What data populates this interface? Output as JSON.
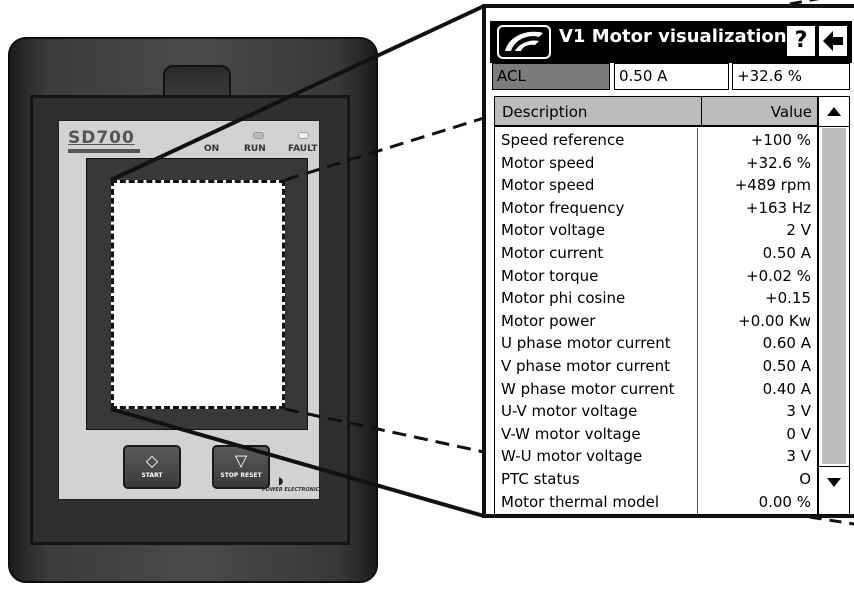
{
  "device": {
    "brand": "SD700",
    "led_labels": {
      "on": "ON",
      "run": "RUN",
      "fault": "FAULT"
    },
    "buttons": {
      "start": "START",
      "stop_reset": "STOP RESET"
    },
    "manufacturer": "POWER ELECTRONICS"
  },
  "screen": {
    "title": "V1 Motor visualization",
    "help_label": "?",
    "back_label": "🡄",
    "status": {
      "mode": "ACL",
      "current": "0.50 A",
      "speed": "+32.6 %"
    },
    "table": {
      "columns": [
        "Description",
        "Value"
      ],
      "rows": [
        {
          "description": "Speed reference",
          "value": "+100 %"
        },
        {
          "description": "Motor speed",
          "value": "+32.6 %"
        },
        {
          "description": "Motor speed",
          "value": "+489 rpm"
        },
        {
          "description": "Motor frequency",
          "value": "+163 Hz"
        },
        {
          "description": "Motor voltage",
          "value": "2 V"
        },
        {
          "description": "Motor current",
          "value": "0.50 A"
        },
        {
          "description": "Motor torque",
          "value": "+0.02 %"
        },
        {
          "description": "Motor phi cosine",
          "value": "+0.15"
        },
        {
          "description": "Motor power",
          "value": "+0.00 Kw"
        },
        {
          "description": "U phase motor current",
          "value": "0.60 A"
        },
        {
          "description": "V phase motor current",
          "value": "0.50 A"
        },
        {
          "description": "W phase motor current",
          "value": "0.40 A"
        },
        {
          "description": "U-V motor voltage",
          "value": "3 V"
        },
        {
          "description": "V-W motor voltage",
          "value": "0 V"
        },
        {
          "description": "W-U motor voltage",
          "value": "3 V"
        },
        {
          "description": "PTC status",
          "value": "O"
        },
        {
          "description": "Motor thermal model",
          "value": "0.00 %"
        }
      ]
    }
  }
}
